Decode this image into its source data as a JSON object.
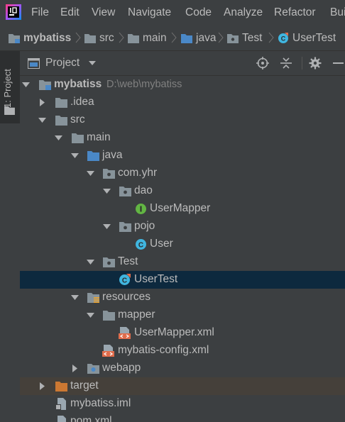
{
  "menu": [
    "File",
    "Edit",
    "View",
    "Navigate",
    "Code",
    "Analyze",
    "Refactor",
    "Build"
  ],
  "breadcrumbs": [
    "mybatiss",
    "src",
    "main",
    "java",
    "Test",
    "UserTest"
  ],
  "sidebar": {
    "tab_label": "1: Project"
  },
  "panel": {
    "title": "Project"
  },
  "tree": [
    {
      "label": "mybatiss",
      "sub": "D:\\web\\mybatiss"
    },
    {
      "label": ".idea"
    },
    {
      "label": "src"
    },
    {
      "label": "main"
    },
    {
      "label": "java"
    },
    {
      "label": "com.yhr"
    },
    {
      "label": "dao"
    },
    {
      "label": "UserMapper"
    },
    {
      "label": "pojo"
    },
    {
      "label": "User"
    },
    {
      "label": "Test"
    },
    {
      "label": "UserTest"
    },
    {
      "label": "resources"
    },
    {
      "label": "mapper"
    },
    {
      "label": "UserMapper.xml"
    },
    {
      "label": "mybatis-config.xml"
    },
    {
      "label": "webapp"
    },
    {
      "label": "target"
    },
    {
      "label": "mybatiss.iml"
    },
    {
      "label": "pom.xml"
    }
  ],
  "colors": {
    "background": "#3c3f41",
    "selection": "#0d293e",
    "folder": "#87939a",
    "source_folder": "#4a88c7",
    "excluded_folder": "#cc7832",
    "interface_icon": "#62b543",
    "class_icon": "#40b6e0"
  }
}
